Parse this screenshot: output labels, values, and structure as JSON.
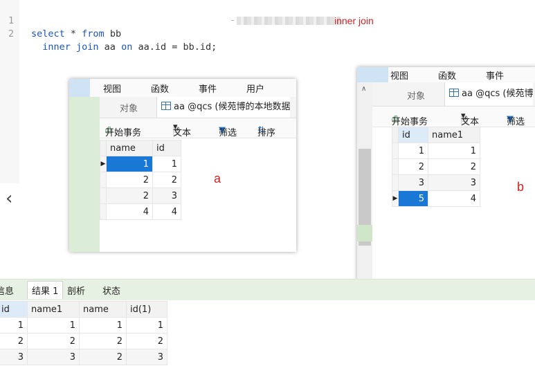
{
  "editor": {
    "lines": [
      {
        "num": "1",
        "parts": [
          {
            "t": "select",
            "c": "kw"
          },
          {
            "t": " * ",
            "c": "pl"
          },
          {
            "t": "from",
            "c": "kw"
          },
          {
            "t": " bb",
            "c": "pl"
          }
        ]
      },
      {
        "num": "2",
        "parts": [
          {
            "t": "  inner join",
            "c": "kw"
          },
          {
            "t": " aa ",
            "c": "pl"
          },
          {
            "t": "on",
            "c": "kw"
          },
          {
            "t": " aa.id = bb.id;",
            "c": "pl"
          }
        ]
      }
    ],
    "annotation": "inner join"
  },
  "panel_a": {
    "menu": [
      "视图",
      "函数",
      "事件",
      "用户"
    ],
    "tab_object": "对象",
    "tab_table": "aa @qcs (候苑博的本地数据",
    "toolbar": {
      "begin": "开始事务",
      "text": "文本",
      "filter": "筛选",
      "sort": "排序"
    },
    "columns": [
      "name",
      "id"
    ],
    "rows": [
      [
        "1",
        "1"
      ],
      [
        "2",
        "2"
      ],
      [
        "2",
        "3"
      ],
      [
        "4",
        "4"
      ]
    ],
    "label": "a"
  },
  "panel_b": {
    "menu": [
      "视图",
      "函数",
      "事件"
    ],
    "tab_object": "对象",
    "tab_table": "aa @qcs (候苑博",
    "toolbar": {
      "begin": "开始事务",
      "text": "文本",
      "filter": "筛选"
    },
    "columns": [
      "id",
      "name1"
    ],
    "rows": [
      [
        "1",
        "1"
      ],
      [
        "2",
        "2"
      ],
      [
        "3",
        "3"
      ],
      [
        "5",
        "4"
      ]
    ],
    "label": "b"
  },
  "result": {
    "tabs": [
      "信息",
      "结果 1",
      "剖析",
      "状态"
    ],
    "columns": [
      "id",
      "name1",
      "name",
      "id(1)"
    ],
    "rows": [
      [
        "1",
        "1",
        "1",
        "1"
      ],
      [
        "2",
        "2",
        "2",
        "2"
      ],
      [
        "3",
        "3",
        "2",
        "3"
      ]
    ]
  },
  "icons": {
    "left_nav": "chevron-left-icon"
  },
  "colors": {
    "keyword": "#1a55c4",
    "annotation": "#d32020",
    "selection": "#1977d6",
    "result_tabs_bg": "#e7f1e3"
  }
}
